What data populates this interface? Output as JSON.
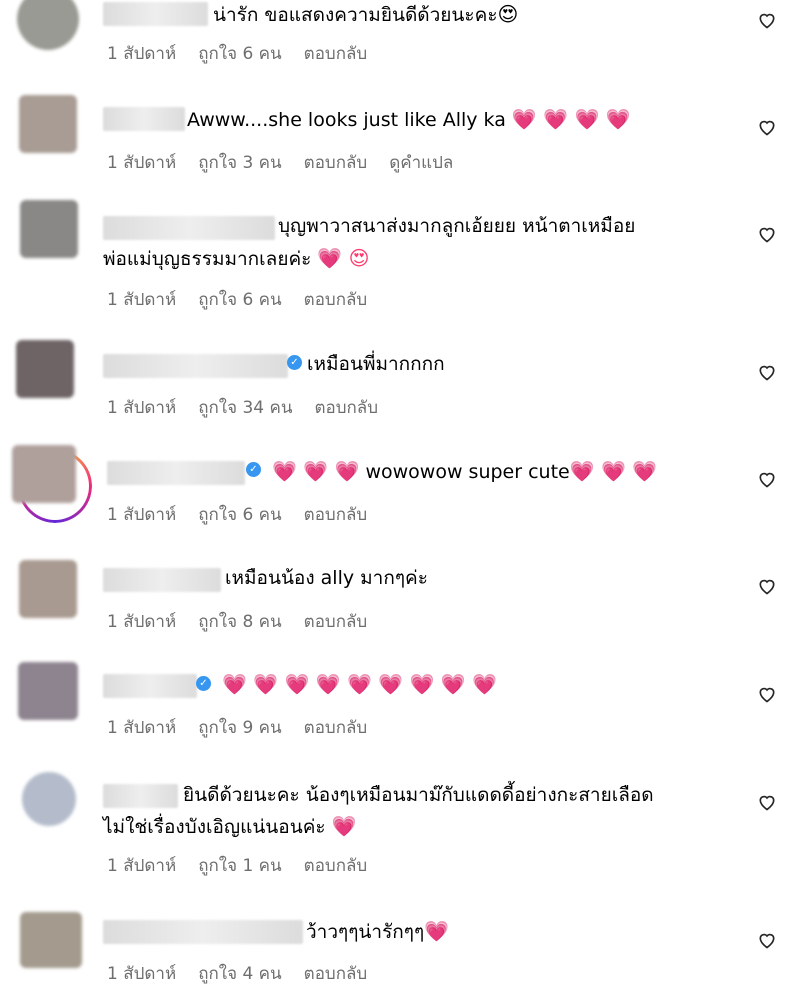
{
  "comments": [
    {
      "text": "น่ารัก ขอแสดงความยินดีด้วยนะคะ",
      "emojis": "😍",
      "time": "1 สัปดาห์",
      "likes": "ถูกใจ 6 คน",
      "reply": "ตอบกลับ"
    },
    {
      "text": "Awww....she looks just like Ally ka",
      "emojis": "💗 💗 💗 💗",
      "time": "1 สัปดาห์",
      "likes": "ถูกใจ 3 คน",
      "reply": "ตอบกลับ",
      "translate": "ดูคำแปล"
    },
    {
      "text_line1": "บุญพาวาสนาส่งมากลูกเอ้ยยย หน้าตาเหมือย",
      "text_line2": "พ่อแม่บุญธรรมมากเลยค่ะ",
      "emojis": "💗 😍",
      "time": "1 สัปดาห์",
      "likes": "ถูกใจ 6 คน",
      "reply": "ตอบกลับ"
    },
    {
      "text": "เหมือนพี่มากกกก",
      "verified": true,
      "time": "1 สัปดาห์",
      "likes": "ถูกใจ 34 คน",
      "reply": "ตอบกลับ"
    },
    {
      "emojis_before": "💗 💗 💗",
      "text": "wowowow super cute",
      "emojis": "💗 💗 💗",
      "verified": true,
      "story_ring": true,
      "time": "1 สัปดาห์",
      "likes": "ถูกใจ 6 คน",
      "reply": "ตอบกลับ"
    },
    {
      "text": "เหมือนน้อง ally มากๆค่ะ",
      "time": "1 สัปดาห์",
      "likes": "ถูกใจ 8 คน",
      "reply": "ตอบกลับ"
    },
    {
      "emojis": "💗 💗 💗 💗 💗 💗 💗 💗 💗",
      "verified": true,
      "time": "1 สัปดาห์",
      "likes": "ถูกใจ 9 คน",
      "reply": "ตอบกลับ"
    },
    {
      "text_line1": "ยินดีด้วยนะคะ น้องๆเหมือนมาม๊กับแดดดี้อย่างกะสายเลือด",
      "text_line2": "ไม่ใช่เรื่องบังเอิญแน่นอนค่ะ",
      "emojis": "💗",
      "time": "1 สัปดาห์",
      "likes": "ถูกใจ 1 คน",
      "reply": "ตอบกลับ"
    },
    {
      "text": "ว้าวๆๆน่ารักๆๆ",
      "emojis": "💗",
      "time": "1 สัปดาห์",
      "likes": "ถูกใจ 4 คน",
      "reply": "ตอบกลับ"
    }
  ],
  "colors": {
    "meta_text": "#6e6e6e",
    "verified_badge": "#3797f0",
    "heart_emoji": "#ff3b6f"
  },
  "icons": {
    "like": "heart-outline-icon",
    "verified": "verified-badge-icon"
  }
}
